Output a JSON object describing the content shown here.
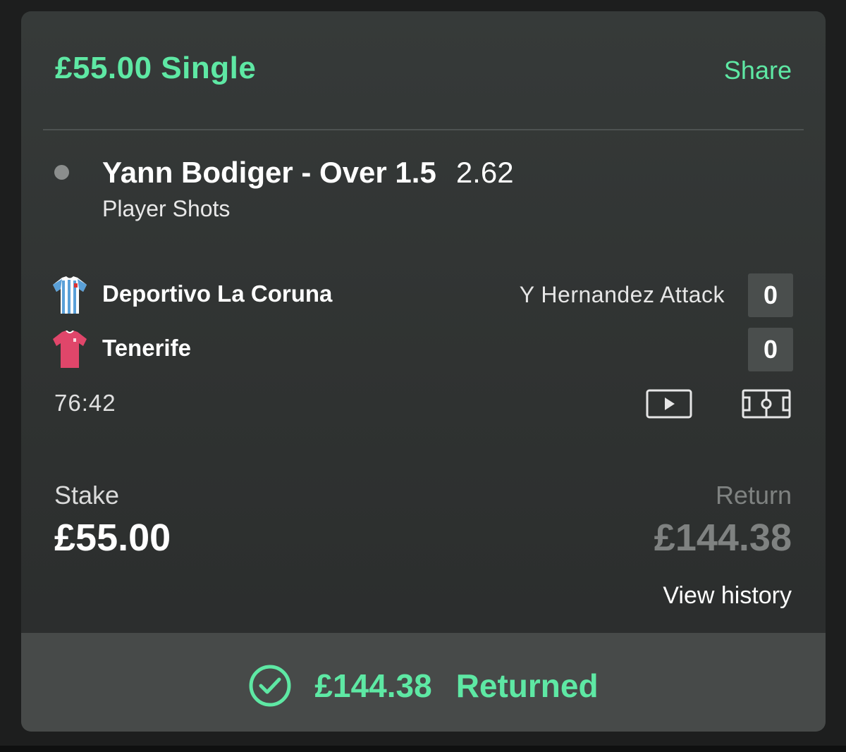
{
  "bet": {
    "title": "£55.00 Single",
    "share_label": "Share"
  },
  "selection": {
    "name": "Yann Bodiger - Over 1.5",
    "odds": "2.62",
    "market": "Player Shots"
  },
  "match": {
    "home_team": "Deportivo La Coruna",
    "home_score": "0",
    "away_team": "Tenerife",
    "away_score": "0",
    "event_note": "Y Hernandez Attack",
    "clock": "76:42"
  },
  "stake": {
    "label": "Stake",
    "value": "£55.00"
  },
  "return": {
    "label": "Return",
    "value": "£144.38",
    "view_history_label": "View history"
  },
  "footer": {
    "amount": "£144.38",
    "status": "Returned"
  },
  "icons": {
    "video": "video-play-icon",
    "pitch": "pitch-icon",
    "check": "check-circle-icon"
  },
  "colors": {
    "accent": "#5ee8a4",
    "card_bg": "#333635",
    "footer_bg": "#474a49",
    "muted": "#7f8281",
    "home_shirt": "#5aa0d8",
    "away_shirt": "#e0466a"
  }
}
